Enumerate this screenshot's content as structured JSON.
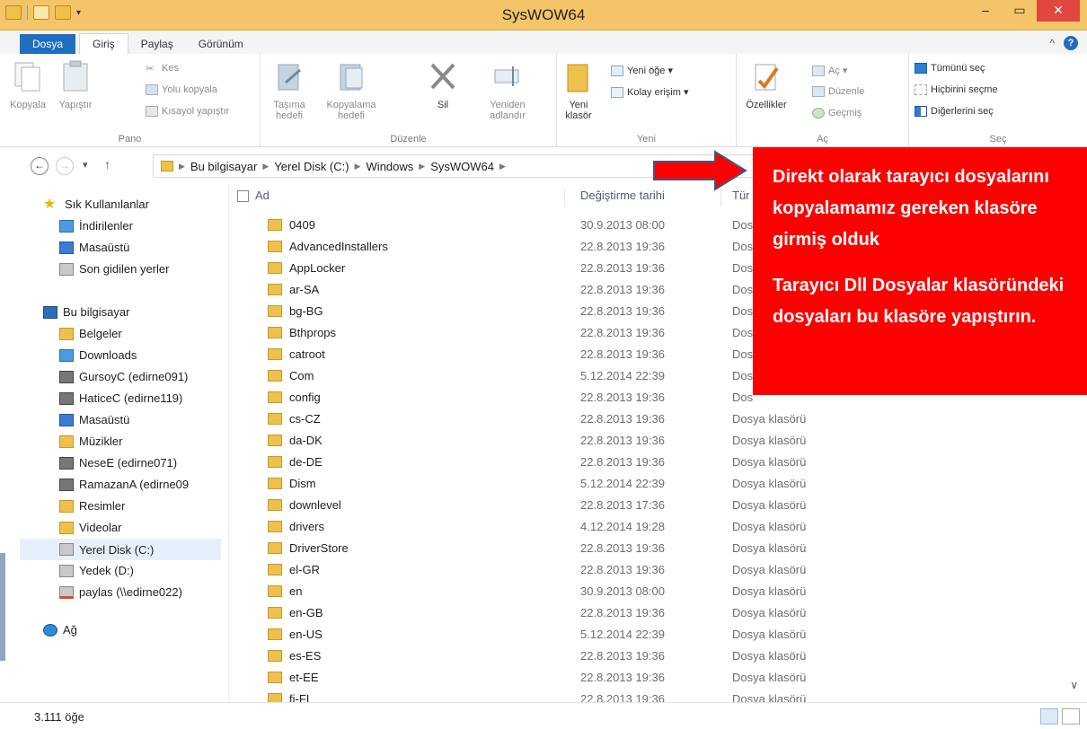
{
  "window": {
    "title": "SysWOW64",
    "close_glyph": "✕",
    "min_glyph": "–",
    "max_glyph": "▭"
  },
  "tabs": [
    "Dosya",
    "Giriş",
    "Paylaş",
    "Görünüm"
  ],
  "ribbon": {
    "pano": {
      "label": "Pano",
      "copy": "Kopyala",
      "paste": "Yapıştır",
      "cut": "Kes",
      "copy_path": "Yolu kopyala",
      "paste_shortcut": "Kısayol yapıştır"
    },
    "duzenle": {
      "label": "Düzenle",
      "move_to": "Taşıma hedefi",
      "copy_to": "Kopyalama hedefi",
      "delete": "Sil",
      "rename": "Yeniden adlandır"
    },
    "yeni": {
      "label": "Yeni",
      "new_folder": "Yeni klasör",
      "new_item": "Yeni öğe ▾",
      "easy_access": "Kolay erişim ▾"
    },
    "ac": {
      "label": "Aç",
      "properties": "Özellikler",
      "open": "Aç ▾",
      "edit": "Düzenle",
      "history": "Geçmiş"
    },
    "sec": {
      "label": "Seç",
      "select_all": "Tümünü seç",
      "select_none": "Hiçbirini seçme",
      "invert": "Diğerlerini seç"
    }
  },
  "breadcrumb": [
    "Bu bilgisayar",
    "Yerel Disk (C:)",
    "Windows",
    "SysWOW64"
  ],
  "nav": {
    "favorites_header": "Sık Kullanılanlar",
    "favorites": [
      "İndirilenler",
      "Masaüstü",
      "Son gidilen yerler"
    ],
    "pc_header": "Bu bilgisayar",
    "pc_items": [
      "Belgeler",
      "Downloads",
      "GursoyC (edirne091)",
      "HaticeC (edirne119)",
      "Masaüstü",
      "Müzikler",
      "NeseE (edirne071)",
      "RamazanA (edirne09",
      "Resimler",
      "Videolar",
      "Yerel Disk (C:)",
      "Yedek (D:)",
      "paylas (\\\\edirne022)"
    ],
    "network": "Ağ"
  },
  "columns": {
    "name": "Ad",
    "date": "Değiştirme tarihi",
    "type": "Tür"
  },
  "files": [
    {
      "name": "0409",
      "date": "30.9.2013 08:00",
      "type": "Dos"
    },
    {
      "name": "AdvancedInstallers",
      "date": "22.8.2013 19:36",
      "type": "Dos"
    },
    {
      "name": "AppLocker",
      "date": "22.8.2013 19:36",
      "type": "Dos"
    },
    {
      "name": "ar-SA",
      "date": "22.8.2013 19:36",
      "type": "Dos"
    },
    {
      "name": "bg-BG",
      "date": "22.8.2013 19:36",
      "type": "Dos"
    },
    {
      "name": "Bthprops",
      "date": "22.8.2013 19:36",
      "type": "Dos"
    },
    {
      "name": "catroot",
      "date": "22.8.2013 19:36",
      "type": "Dos"
    },
    {
      "name": "Com",
      "date": "5.12.2014 22:39",
      "type": "Dos"
    },
    {
      "name": "config",
      "date": "22.8.2013 19:36",
      "type": "Dos"
    },
    {
      "name": "cs-CZ",
      "date": "22.8.2013 19:36",
      "type": "Dosya klasörü"
    },
    {
      "name": "da-DK",
      "date": "22.8.2013 19:36",
      "type": "Dosya klasörü"
    },
    {
      "name": "de-DE",
      "date": "22.8.2013 19:36",
      "type": "Dosya klasörü"
    },
    {
      "name": "Dism",
      "date": "5.12.2014 22:39",
      "type": "Dosya klasörü"
    },
    {
      "name": "downlevel",
      "date": "22.8.2013 17:36",
      "type": "Dosya klasörü"
    },
    {
      "name": "drivers",
      "date": "4.12.2014 19:28",
      "type": "Dosya klasörü"
    },
    {
      "name": "DriverStore",
      "date": "22.8.2013 19:36",
      "type": "Dosya klasörü"
    },
    {
      "name": "el-GR",
      "date": "22.8.2013 19:36",
      "type": "Dosya klasörü"
    },
    {
      "name": "en",
      "date": "30.9.2013 08:00",
      "type": "Dosya klasörü"
    },
    {
      "name": "en-GB",
      "date": "22.8.2013 19:36",
      "type": "Dosya klasörü"
    },
    {
      "name": "en-US",
      "date": "5.12.2014 22:39",
      "type": "Dosya klasörü"
    },
    {
      "name": "es-ES",
      "date": "22.8.2013 19:36",
      "type": "Dosya klasörü"
    },
    {
      "name": "et-EE",
      "date": "22.8.2013 19:36",
      "type": "Dosya klasörü"
    },
    {
      "name": "fi-FI",
      "date": "22.8.2013 19:36",
      "type": "Dosya klasörü"
    }
  ],
  "status": {
    "count": "3.111 öğe"
  },
  "annotation": {
    "text1": "Direkt olarak tarayıcı dosyalarını kopyalamamız gereken klasöre girmiş olduk",
    "text2": "Tarayıcı Dll Dosyalar klasöründeki dosyaları bu klasöre yapıştırın.",
    "color": "#fe0000"
  },
  "colors": {
    "titlebar": "#f3c568",
    "file_tab": "#1f6fc0",
    "folder": "#f0c04c"
  }
}
